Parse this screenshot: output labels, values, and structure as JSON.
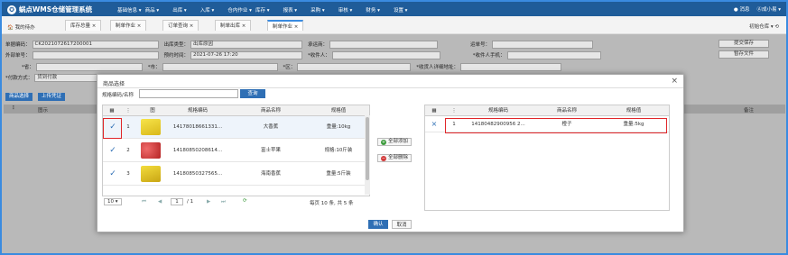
{
  "app": {
    "title": "蜗点WMS仓储管理系统",
    "logo_glyph": "✪"
  },
  "menu": [
    "基础信息 ▾",
    "商品 ▾",
    "出库 ▾",
    "入库 ▾",
    "仓内作业 ▾",
    "库存 ▾",
    "报表 ▾",
    "采购 ▾",
    "审核 ▾",
    "财务 ▾",
    "设置 ▾"
  ],
  "top_right": {
    "messages": "● 消息",
    "user": "Ⓐ成小易 ▾"
  },
  "tabs": {
    "home": "🏠 我的待办",
    "items": [
      "库存总量 ×",
      "制单作业 ×",
      "订单查询 ×",
      "制单出库 ×",
      "制单作业 ×"
    ],
    "warehouse": "初始仓库 ▾ ⟲"
  },
  "form": {
    "order_no_label": "单据编码：",
    "order_no": "CK2021072617200001",
    "type_label": "出库类型：",
    "type": "出库原因",
    "carrier_label": "承运商：",
    "waybill_label": "运单号：",
    "ext_no_label": "外部单号：",
    "time_label": "预约时间：",
    "time": "2021-07-26 17:20",
    "receiver_label": "*收件人：",
    "receiver_phone_label": "*收件人手机：",
    "province_label": "*省：",
    "city_label": "*市：",
    "district_label": "*区：",
    "address_label": "*收货人详细地址：",
    "pay_label": "*付款方式：",
    "pay": "货到付款",
    "submit": "提交保存",
    "draft": "暂存文件"
  },
  "actions": {
    "select_goods": "商品选择",
    "upload": "上传凭证"
  },
  "bg_table": {
    "col_image": "图示",
    "col_remark": "备注",
    "col_menu": "⋮"
  },
  "modal": {
    "title": "商品选择",
    "close": "×",
    "search_label": "规格编码/名称",
    "search_button": "查询",
    "left_headers": [
      "",
      "⋮",
      "图",
      "规格编码",
      "商品名称",
      "规格值"
    ],
    "left_rows": [
      {
        "checked": "✓",
        "idx": "1",
        "code": "14178018661331...",
        "name": "大香蕉",
        "spec": "重量:10kg",
        "color": "#f0d020"
      },
      {
        "checked": "✓",
        "idx": "2",
        "code": "14180850208614...",
        "name": "富士苹果",
        "spec": "规格:10斤装",
        "color": "#d83a3a"
      },
      {
        "checked": "✓",
        "idx": "3",
        "code": "14180850327565...",
        "name": "海南香蕉",
        "spec": "重量:5斤装",
        "color": "#e8c428"
      }
    ],
    "add_all": "全部添加",
    "remove_all": "全部删除",
    "right_headers": [
      "",
      "⋮",
      "规格编码",
      "商品名称",
      "规格值"
    ],
    "right_rows": [
      {
        "del": "×",
        "idx": "1",
        "code": "14180482900956 2...",
        "name": "橙子",
        "spec": "重量:5kg"
      }
    ],
    "pager": {
      "size": "10 ▾",
      "first": "⏮",
      "prev": "◀",
      "page": "1",
      "total": "/ 1",
      "next": "▶",
      "last": "⏭",
      "refresh": "⟳",
      "info": "每页 10 条, 共 5 条"
    },
    "confirm": "确认",
    "cancel": "取消"
  }
}
